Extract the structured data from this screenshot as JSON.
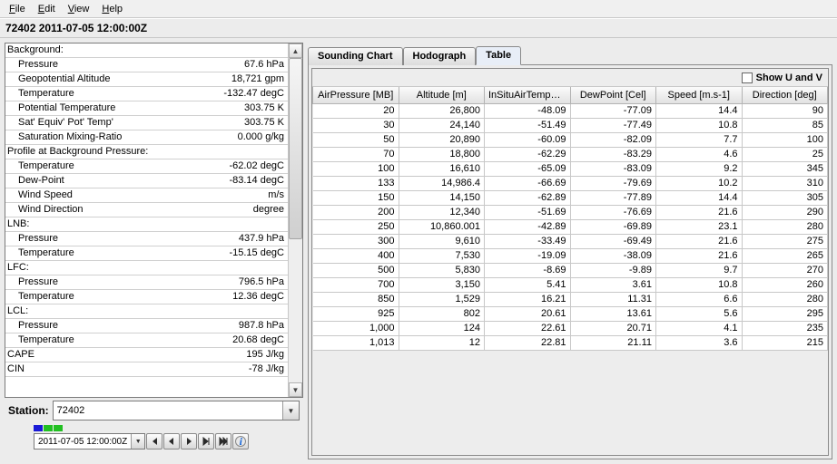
{
  "menu": {
    "file": "File",
    "edit": "Edit",
    "view": "View",
    "help": "Help"
  },
  "header_title": "72402 2011-07-05 12:00:00Z",
  "station": {
    "label": "Station:",
    "value": "72402"
  },
  "time_selector": {
    "value": "2011-07-05 12:00:00Z"
  },
  "left_panel": {
    "rows": [
      {
        "section": true,
        "label": "Background:",
        "value": ""
      },
      {
        "section": false,
        "label": "Pressure",
        "value": "67.6 hPa"
      },
      {
        "section": false,
        "label": "Geopotential Altitude",
        "value": "18,721 gpm"
      },
      {
        "section": false,
        "label": "Temperature",
        "value": "-132.47 degC"
      },
      {
        "section": false,
        "label": "Potential Temperature",
        "value": "303.75 K"
      },
      {
        "section": false,
        "label": "Sat' Equiv' Pot' Temp'",
        "value": "303.75 K"
      },
      {
        "section": false,
        "label": "Saturation Mixing-Ratio",
        "value": "0.000 g/kg"
      },
      {
        "section": true,
        "label": "Profile at Background Pressure:",
        "value": ""
      },
      {
        "section": false,
        "label": "Temperature",
        "value": "-62.02 degC"
      },
      {
        "section": false,
        "label": "Dew-Point",
        "value": "-83.14 degC"
      },
      {
        "section": false,
        "label": "Wind Speed",
        "value": "m/s"
      },
      {
        "section": false,
        "label": "Wind Direction",
        "value": "degree"
      },
      {
        "section": true,
        "label": "LNB:",
        "value": ""
      },
      {
        "section": false,
        "label": "Pressure",
        "value": "437.9 hPa"
      },
      {
        "section": false,
        "label": "Temperature",
        "value": "-15.15 degC"
      },
      {
        "section": true,
        "label": "LFC:",
        "value": ""
      },
      {
        "section": false,
        "label": "Pressure",
        "value": "796.5 hPa"
      },
      {
        "section": false,
        "label": "Temperature",
        "value": "12.36 degC"
      },
      {
        "section": true,
        "label": "LCL:",
        "value": ""
      },
      {
        "section": false,
        "label": "Pressure",
        "value": "987.8 hPa"
      },
      {
        "section": false,
        "label": "Temperature",
        "value": "20.68 degC"
      },
      {
        "section": true,
        "label": "CAPE",
        "value": "195 J/kg"
      },
      {
        "section": true,
        "label": "CIN",
        "value": "-78 J/kg"
      }
    ]
  },
  "tabs": {
    "chart": "Sounding Chart",
    "hodo": "Hodograph",
    "table": "Table"
  },
  "show_uv_label": "Show U and V",
  "table": {
    "headers": [
      "AirPressure [MB]",
      "Altitude [m]",
      "InSituAirTemper...",
      "DewPoint [Cel]",
      "Speed [m.s-1]",
      "Direction [deg]"
    ],
    "rows": [
      [
        "20",
        "26,800",
        "-48.09",
        "-77.09",
        "14.4",
        "90"
      ],
      [
        "30",
        "24,140",
        "-51.49",
        "-77.49",
        "10.8",
        "85"
      ],
      [
        "50",
        "20,890",
        "-60.09",
        "-82.09",
        "7.7",
        "100"
      ],
      [
        "70",
        "18,800",
        "-62.29",
        "-83.29",
        "4.6",
        "25"
      ],
      [
        "100",
        "16,610",
        "-65.09",
        "-83.09",
        "9.2",
        "345"
      ],
      [
        "133",
        "14,986.4",
        "-66.69",
        "-79.69",
        "10.2",
        "310"
      ],
      [
        "150",
        "14,150",
        "-62.89",
        "-77.89",
        "14.4",
        "305"
      ],
      [
        "200",
        "12,340",
        "-51.69",
        "-76.69",
        "21.6",
        "290"
      ],
      [
        "250",
        "10,860.001",
        "-42.89",
        "-69.89",
        "23.1",
        "280"
      ],
      [
        "300",
        "9,610",
        "-33.49",
        "-69.49",
        "21.6",
        "275"
      ],
      [
        "400",
        "7,530",
        "-19.09",
        "-38.09",
        "21.6",
        "265"
      ],
      [
        "500",
        "5,830",
        "-8.69",
        "-9.89",
        "9.7",
        "270"
      ],
      [
        "700",
        "3,150",
        "5.41",
        "3.61",
        "10.8",
        "260"
      ],
      [
        "850",
        "1,529",
        "16.21",
        "11.31",
        "6.6",
        "280"
      ],
      [
        "925",
        "802",
        "20.61",
        "13.61",
        "5.6",
        "295"
      ],
      [
        "1,000",
        "124",
        "22.61",
        "20.71",
        "4.1",
        "235"
      ],
      [
        "1,013",
        "12",
        "22.81",
        "21.11",
        "3.6",
        "215"
      ]
    ]
  }
}
